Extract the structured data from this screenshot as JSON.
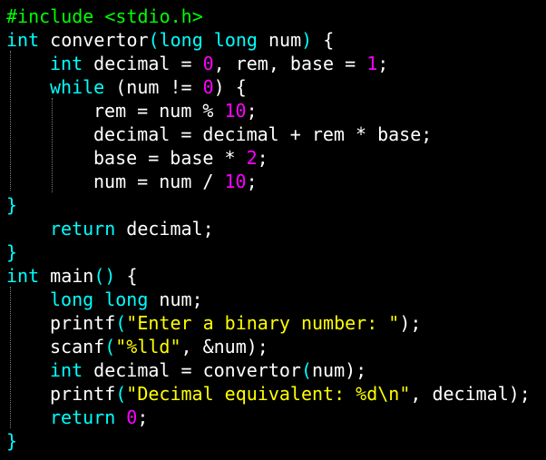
{
  "code": {
    "line1": {
      "directive": "#include <stdio.h>"
    },
    "line2": {
      "type": "int",
      "name": "convertor",
      "p_open": "(",
      "param_type": "long long",
      "param_name": "num",
      "p_close": ")",
      "brace": " {"
    },
    "line3": {
      "type": "int",
      "decl": " decimal = ",
      "zero": "0",
      "mid": ", rem, base = ",
      "one": "1",
      "end": ";"
    },
    "line4": {
      "keyword": "while",
      "open": " (num != ",
      "zero": "0",
      "close": ") {"
    },
    "line5": {
      "pre": "rem = num % ",
      "ten": "10",
      "end": ";"
    },
    "line6": {
      "text": "decimal = decimal + rem * base;"
    },
    "line7": {
      "pre": "base = base * ",
      "two": "2",
      "end": ";"
    },
    "line8": {
      "pre": "num = num / ",
      "ten": "10",
      "end": ";"
    },
    "line9": {
      "brace": "}"
    },
    "line10": {
      "keyword": "return",
      "rest": " decimal;"
    },
    "line11": {
      "brace": "}"
    },
    "line12": {
      "type": "int",
      "name": " main",
      "parens": "()",
      "brace": " {"
    },
    "line13": {
      "type": "long long",
      "rest": " num;"
    },
    "line14": {
      "fn": "printf",
      "open": "(",
      "str": "\"Enter a binary number: \"",
      "close": ");"
    },
    "line15": {
      "fn": "scanf",
      "open": "(",
      "str": "\"%lld\"",
      "close": ", &num);"
    },
    "line16": {
      "type": "int",
      "decl": " decimal = convertor",
      "open": "(",
      "arg": "num",
      "close": ");"
    },
    "line17": {
      "fn": "printf",
      "open": "(",
      "str": "\"Decimal equivalent: %d\\n\"",
      "close": ", decimal);"
    },
    "line18": {
      "keyword": "return",
      "space": " ",
      "zero": "0",
      "end": ";"
    },
    "line19": {
      "brace": "}"
    }
  },
  "colors": {
    "background": "#000000",
    "keyword": "#00ffff",
    "number": "#ff00ff",
    "string": "#ffff00",
    "preprocessor": "#00ff00",
    "text": "#ffffff"
  }
}
